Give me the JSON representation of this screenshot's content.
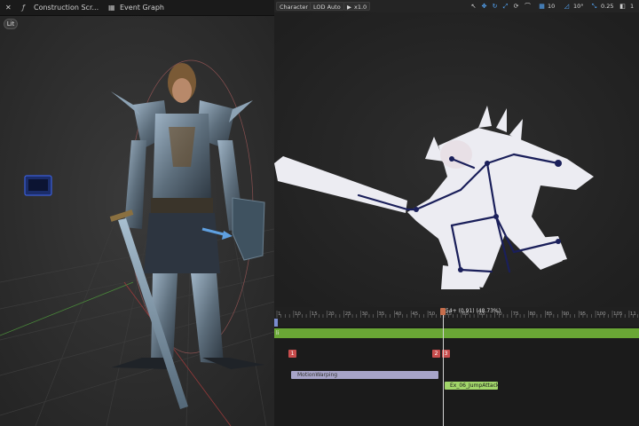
{
  "left_panel": {
    "tabs": [
      {
        "icon": "close-icon",
        "label": "✕"
      },
      {
        "icon": "function-icon",
        "label": "Construction Scr..."
      },
      {
        "icon": "graph-icon",
        "label": "Event Graph"
      }
    ],
    "lit_label": "Lit"
  },
  "right_panel": {
    "toolbar": {
      "character_label": "Character",
      "lod_label": "LOD Auto",
      "play_rate": "x1.0",
      "grid_value": "10",
      "angle_value": "10°",
      "scale_value": "0.25",
      "camera_speed": "1"
    }
  },
  "timeline": {
    "ticks": [
      "1",
      "10",
      "15",
      "20",
      "25",
      "30",
      "35",
      "40",
      "45",
      "50",
      "55",
      "60",
      "65",
      "70",
      "75",
      "80",
      "85",
      "90",
      "95",
      "100",
      "105",
      "11"
    ],
    "playhead_label": "54+ (0.91) (48.73%)",
    "track_label": "li",
    "markers": [
      "1",
      "2",
      "3"
    ],
    "motion_warping_label": "MotionWarping",
    "notify_label": "Ex_06_JumpAttack"
  },
  "colors": {
    "track_green": "#6aa735",
    "marker_red": "#c84d4d",
    "motion_warping_purple": "#a7a4c9",
    "notify_green": "#a2d66a",
    "accent_blue": "#55aaff"
  }
}
